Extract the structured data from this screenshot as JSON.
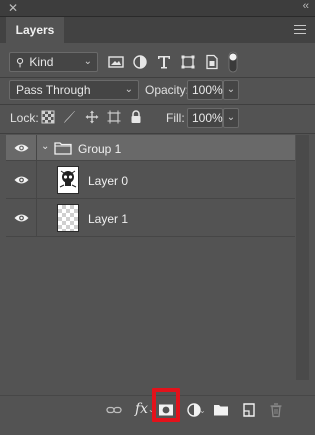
{
  "panel": {
    "tab_label": "Layers"
  },
  "filter": {
    "kind_label": "Kind",
    "icons": [
      "pixel-layer-filter-icon",
      "adjustment-layer-filter-icon",
      "type-layer-filter-icon",
      "shape-layer-filter-icon",
      "smart-object-filter-icon",
      "filter-toggle-icon"
    ]
  },
  "blend": {
    "mode": "Pass Through",
    "opacity_label": "Opacity:",
    "opacity_value": "100%"
  },
  "lock": {
    "label": "Lock:",
    "icons": [
      "lock-transparent-pixels-icon",
      "lock-image-pixels-icon",
      "lock-position-icon",
      "prevent-autonest-icon",
      "lock-all-icon"
    ],
    "fill_label": "Fill:",
    "fill_value": "100%"
  },
  "layers": [
    {
      "name": "Group 1",
      "type": "group",
      "visible": true,
      "selected": true
    },
    {
      "name": "Layer 0",
      "type": "pixel",
      "visible": true,
      "selected": false
    },
    {
      "name": "Layer 1",
      "type": "pixel",
      "visible": true,
      "selected": false
    }
  ],
  "bottom_toolbar": {
    "icons": [
      "link-layers-icon",
      "layer-style-fx-icon",
      "add-layer-mask-icon",
      "new-fill-adjustment-icon",
      "new-group-icon",
      "new-layer-icon",
      "delete-layer-icon"
    ],
    "fx_label": "fx",
    "highlighted": "add-layer-mask-icon"
  },
  "colors": {
    "panel_bg": "#535353",
    "selected_row_bg": "#696969",
    "highlight_red": "#e3121b"
  }
}
